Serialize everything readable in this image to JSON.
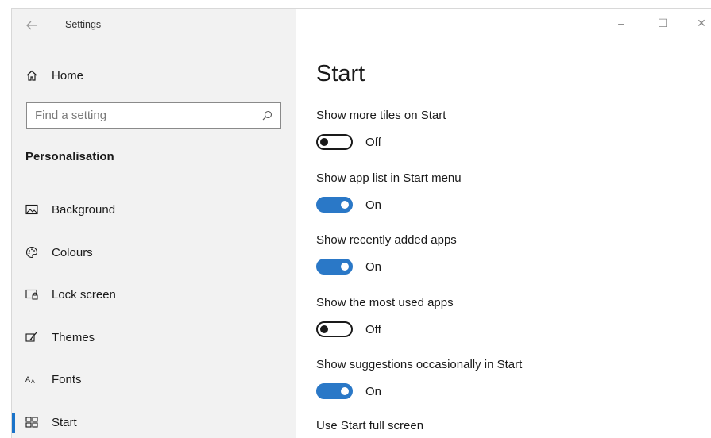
{
  "window": {
    "title": "Settings",
    "controls": {
      "minimize": "–",
      "maximize": "☐",
      "close": "✕"
    }
  },
  "sidebar": {
    "home_label": "Home",
    "search_placeholder": "Find a setting",
    "section_title": "Personalisation",
    "items": [
      {
        "label": "Background",
        "icon": "picture-icon"
      },
      {
        "label": "Colours",
        "icon": "palette-icon"
      },
      {
        "label": "Lock screen",
        "icon": "lock-screen-icon"
      },
      {
        "label": "Themes",
        "icon": "brush-icon"
      },
      {
        "label": "Fonts",
        "icon": "font-icon"
      },
      {
        "label": "Start",
        "icon": "start-icon",
        "active": true
      }
    ]
  },
  "main": {
    "title": "Start",
    "settings": [
      {
        "label": "Show more tiles on Start",
        "state": "Off"
      },
      {
        "label": "Show app list in Start menu",
        "state": "On"
      },
      {
        "label": "Show recently added apps",
        "state": "On"
      },
      {
        "label": "Show the most used apps",
        "state": "Off"
      },
      {
        "label": "Show suggestions occasionally in Start",
        "state": "On"
      },
      {
        "label": "Use Start full screen",
        "state": ""
      }
    ]
  },
  "colors": {
    "accent": "#2a78c7",
    "sidebar_bg": "#f2f2f2"
  }
}
